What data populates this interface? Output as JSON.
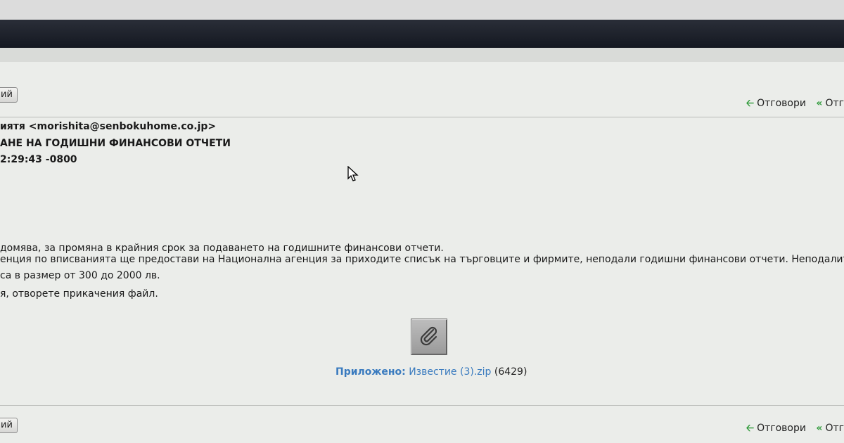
{
  "toolbar": {
    "button_label": "ий",
    "actions": [
      {
        "label": "Отговори",
        "icon": "reply-icon"
      },
      {
        "label": "Отг",
        "icon": "reply-all-icon"
      }
    ]
  },
  "message": {
    "from": "иятя <morishita@senbokuhome.co.jp>",
    "subject": "АНЕ НА ГОДИШНИ ФИНАНСОВИ ОТЧЕТИ",
    "date": "2:29:43 -0800",
    "body": [
      "домява, за промяна в крайния срок за подаването на годишните финансови отчети.",
      "енция по вписванията ще предостави на Национална агенция за приходите списък на търговците и фирмите, неподали годишни финансови отчети. Неподалите в",
      "са в размер от 300 до 2000 лв.",
      "я, отворете прикачения файл."
    ]
  },
  "attachment": {
    "label": "Приложено:",
    "filename": "Известие (3).zip",
    "size": "(6429)",
    "icon": "paperclip-icon"
  },
  "colors": {
    "accent": "#3a7bbf",
    "arrow": "#2f9a3a",
    "background": "#ebedea"
  }
}
